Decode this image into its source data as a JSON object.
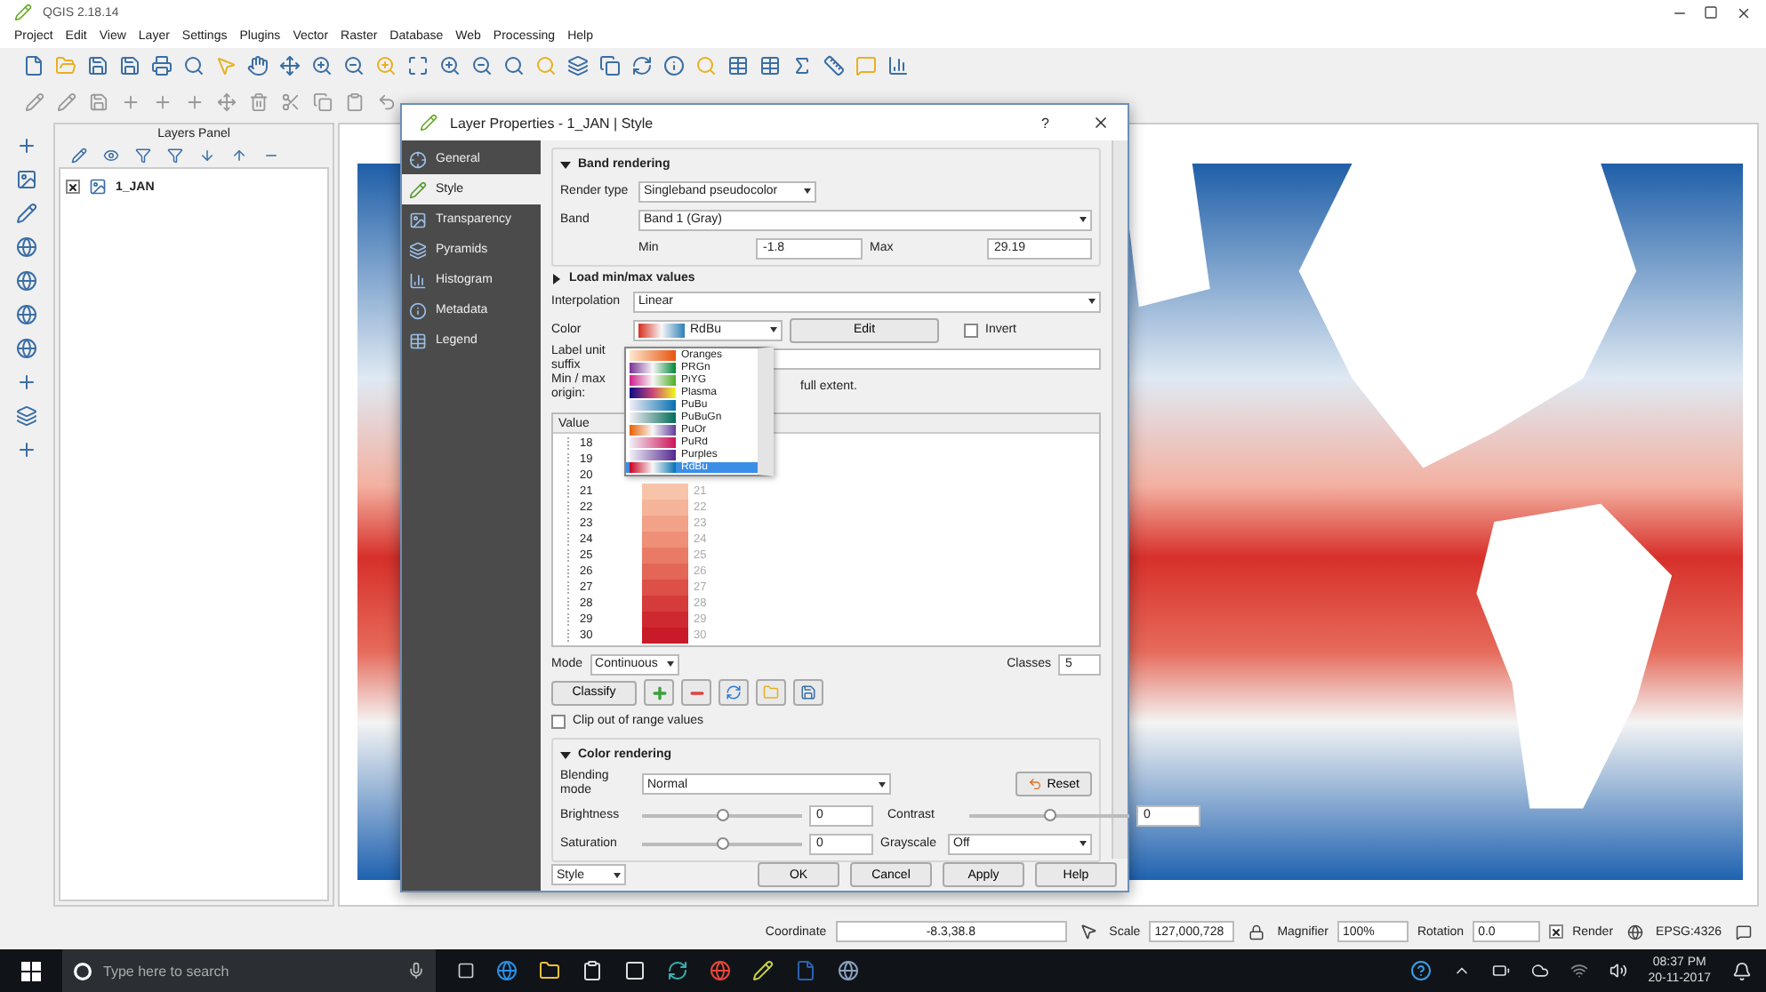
{
  "app": {
    "title": "QGIS 2.18.14"
  },
  "menu": [
    "Project",
    "Edit",
    "View",
    "Layer",
    "Settings",
    "Plugins",
    "Vector",
    "Raster",
    "Database",
    "Web",
    "Processing",
    "Help"
  ],
  "layers_panel": {
    "title": "Layers Panel",
    "layers": [
      {
        "name": "1_JAN",
        "checked": true
      }
    ]
  },
  "dialog": {
    "title": "Layer Properties - 1_JAN | Style",
    "help": "?",
    "nav": [
      {
        "label": "General",
        "selected": false
      },
      {
        "label": "Style",
        "selected": true
      },
      {
        "label": "Transparency",
        "selected": false
      },
      {
        "label": "Pyramids",
        "selected": false
      },
      {
        "label": "Histogram",
        "selected": false
      },
      {
        "label": "Metadata",
        "selected": false
      },
      {
        "label": "Legend",
        "selected": false
      }
    ],
    "band_rendering": {
      "title": "Band rendering",
      "expanded": true,
      "render_type_label": "Render type",
      "render_type": "Singleband pseudocolor",
      "band_label": "Band",
      "band": "Band 1 (Gray)",
      "min_label": "Min",
      "min": "-1.8",
      "max_label": "Max",
      "max": "29.19"
    },
    "load_minmax": {
      "title": "Load min/max values",
      "expanded": false
    },
    "interpolation_label": "Interpolation",
    "interpolation": "Linear",
    "color_label": "Color",
    "color_ramp": "RdBu",
    "edit_button": "Edit",
    "invert": {
      "label": "Invert",
      "checked": false
    },
    "label_unit_suffix_label": "Label unit suffix",
    "minmax_origin_label": "Min / max origin:",
    "minmax_origin_text": "full extent.",
    "ramp_list": [
      {
        "name": "Oranges",
        "selected": false
      },
      {
        "name": "PRGn",
        "selected": false
      },
      {
        "name": "PiYG",
        "selected": false
      },
      {
        "name": "Plasma",
        "selected": false
      },
      {
        "name": "PuBu",
        "selected": false
      },
      {
        "name": "PuBuGn",
        "selected": false
      },
      {
        "name": "PuOr",
        "selected": false
      },
      {
        "name": "PuRd",
        "selected": false
      },
      {
        "name": "Purples",
        "selected": false
      },
      {
        "name": "RdBu",
        "selected": true
      }
    ],
    "table": {
      "columns": [
        "Value"
      ],
      "rows": [
        {
          "value": "18"
        },
        {
          "value": "19"
        },
        {
          "value": "20"
        },
        {
          "value": "21",
          "color": "#f7c4aa",
          "label": "21"
        },
        {
          "value": "22",
          "color": "#f5b49a",
          "label": "22"
        },
        {
          "value": "23",
          "color": "#f2a288",
          "label": "23"
        },
        {
          "value": "24",
          "color": "#ee8f77",
          "label": "24"
        },
        {
          "value": "25",
          "color": "#e97b66",
          "label": "25"
        },
        {
          "value": "26",
          "color": "#e36656",
          "label": "26"
        },
        {
          "value": "27",
          "color": "#dc5047",
          "label": "27"
        },
        {
          "value": "28",
          "color": "#d53b3a",
          "label": "28"
        },
        {
          "value": "29",
          "color": "#ce2830",
          "label": "29"
        },
        {
          "value": "30",
          "color": "#c81a28",
          "label": "30"
        }
      ]
    },
    "mode_label": "Mode",
    "mode": "Continuous",
    "classes_label": "Classes",
    "classes": "5",
    "classify_button": "Classify",
    "clip": {
      "label": "Clip out of range values",
      "checked": false
    },
    "color_rendering": {
      "title": "Color rendering",
      "expanded": true,
      "blending_label": "Blending mode",
      "blending": "Normal",
      "reset_button": "Reset",
      "brightness": {
        "label": "Brightness",
        "level": 0.5,
        "value": "0"
      },
      "contrast": {
        "label": "Contrast",
        "level": 0.5,
        "value": "0"
      },
      "saturation": {
        "label": "Saturation",
        "level": 0.5,
        "value": "0"
      },
      "grayscale_label": "Grayscale",
      "grayscale": "Off"
    },
    "style_button": "Style",
    "buttons": [
      "OK",
      "Cancel",
      "Apply",
      "Help"
    ]
  },
  "status_bar": {
    "coordinate_label": "Coordinate",
    "coordinate": "-8.3,38.8",
    "scale_label": "Scale",
    "scale": "127,000,728",
    "magnifier_label": "Magnifier",
    "magnifier": "100%",
    "rotation_label": "Rotation",
    "rotation": "0.0",
    "render": {
      "label": "Render",
      "checked": true
    },
    "crs": "EPSG:4326"
  },
  "taskbar": {
    "search_placeholder": "Type here to search",
    "time": "08:37 PM",
    "date": "20-11-2017"
  }
}
